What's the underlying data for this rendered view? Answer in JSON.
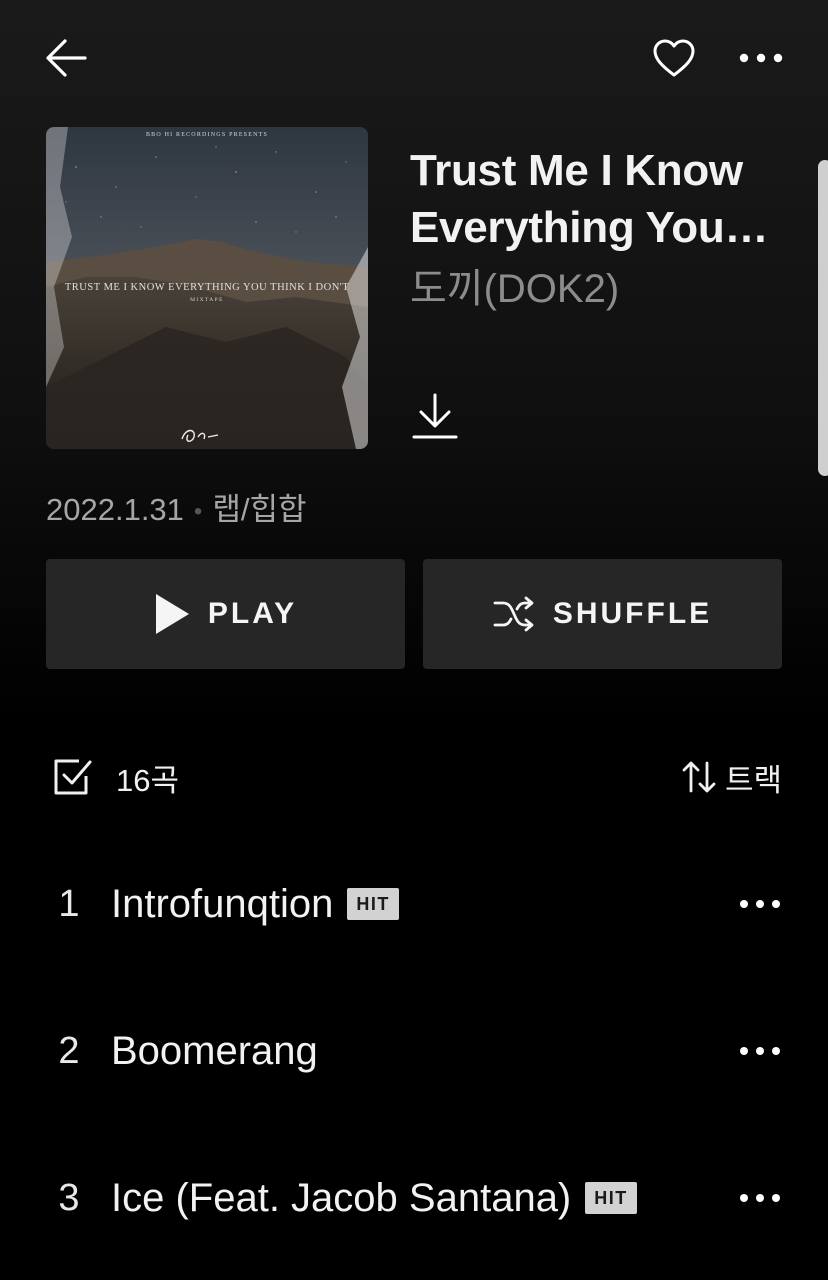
{
  "album": {
    "title": "Trust Me I Know Everything You Think I Don't",
    "artist": "도끼(DOK2)",
    "date": "2022.1.31",
    "genre": "랩/힙합",
    "cover_top_text": "BBO HI RECORDINGS PRESENTS",
    "cover_title_text": "TRUST ME I KNOW EVERYTHING YOU THINK I DON'T",
    "cover_subtitle_text": "MIXTAPE"
  },
  "actions": {
    "play_label": "PLAY",
    "shuffle_label": "SHUFFLE"
  },
  "list_header": {
    "count_label": "16곡",
    "sort_label": "트랙"
  },
  "tracks": [
    {
      "num": "1",
      "title": "Introfunqtion",
      "badge": "HIT"
    },
    {
      "num": "2",
      "title": "Boomerang",
      "badge": ""
    },
    {
      "num": "3",
      "title": "Ice (Feat. Jacob Santana)",
      "badge": "HIT"
    }
  ],
  "icons": {
    "back": "arrow-left-icon",
    "like": "heart-icon",
    "more": "more-horizontal-icon",
    "download": "download-icon",
    "play": "play-icon",
    "shuffle": "shuffle-icon",
    "select": "checkbox-icon",
    "sort": "sort-arrows-icon"
  },
  "colors": {
    "background": "#000000",
    "button_bg": "#262626",
    "artist_text": "#8c8c8c",
    "hit_badge": "#d2d2d2"
  }
}
